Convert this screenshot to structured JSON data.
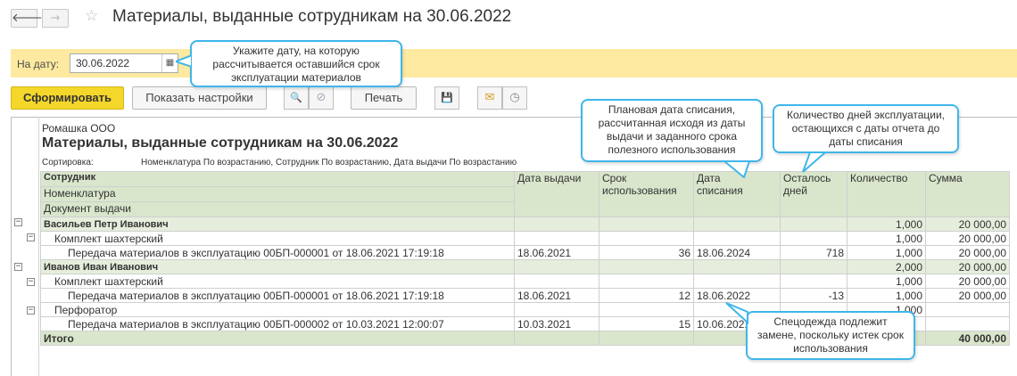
{
  "window": {
    "title": "Материалы, выданные сотрудникам на 30.06.2022",
    "back_glyph": "🡐",
    "fwd_glyph": "→",
    "star_glyph": "☆"
  },
  "datebar": {
    "label": "На дату:",
    "value": "30.06.2022",
    "calendar_glyph": "▦"
  },
  "toolbar": {
    "generate_label": "Сформировать",
    "settings_label": "Показать настройки",
    "print_label": "Печать",
    "search_glyph": "🔍",
    "clear_glyph": "⊘",
    "save_glyph": "💾",
    "mail_glyph": "✉",
    "clock_glyph": "◷"
  },
  "report": {
    "org": "Ромашка ООО",
    "title": "Материалы, выданные сотрудникам на 30.06.2022",
    "sort_label": "Сортировка:",
    "sort_value": "Номенклатура По возрастанию, Сотрудник По возрастанию, Дата выдачи По возрастанию",
    "headers": {
      "employee": "Сотрудник",
      "nomenclature": "Номенклатура",
      "document": "Документ выдачи",
      "issue_date": "Дата выдачи",
      "usage_term_1": "Срок",
      "usage_term_2": "использования",
      "writeoff_1": "Дата",
      "writeoff_2": "списания",
      "remaining_1": "Осталось",
      "remaining_2": "дней",
      "quantity": "Количество",
      "sum": "Сумма"
    },
    "rows": [
      {
        "name": "Васильев Петр Иванович",
        "qty": "1,000",
        "sum": "20 000,00"
      },
      {
        "name": "Комплект шахтерский",
        "qty": "1,000",
        "sum": "20 000,00"
      },
      {
        "name": "Передача материалов в эксплуатацию 00БП-000001 от 18.06.2021 17:19:18",
        "issue": "18.06.2021",
        "term": "36",
        "writeoff": "18.06.2024",
        "remain": "718",
        "qty": "1,000",
        "sum": "20 000,00"
      },
      {
        "name": "Иванов Иван Иванович",
        "qty": "2,000",
        "sum": "20 000,00"
      },
      {
        "name": "Комплект шахтерский",
        "qty": "1,000",
        "sum": "20 000,00"
      },
      {
        "name": "Передача материалов в эксплуатацию 00БП-000001 от 18.06.2021 17:19:18",
        "issue": "18.06.2021",
        "term": "12",
        "writeoff": "18.06.2022",
        "remain": "-13",
        "qty": "1,000",
        "sum": "20 000,00"
      },
      {
        "name": "Перфоратор",
        "qty": "1,000",
        "sum": ""
      },
      {
        "name": "Передача материалов в эксплуатацию 00БП-000002 от 10.03.2021 12:00:07",
        "issue": "10.03.2021",
        "term": "15",
        "writeoff": "10.06.2021",
        "remain": "",
        "qty": "",
        "sum": ""
      },
      {
        "name": "Итого",
        "qty": "",
        "sum": "40 000,00"
      }
    ],
    "toggle_glyph": "−"
  },
  "callouts": {
    "date_hint": "Укажите дату, на которую рассчитывается оставшийся срок эксплуатации материалов",
    "writeoff_hint": "Плановая дата списания, рассчитанная исходя из даты выдачи и заданного срока полезного использования",
    "days_hint": "Количество дней эксплуатации, остающихся с даты отчета до даты списания",
    "replace_hint": "Спецодежда подлежит замене, поскольку истек срок использования"
  },
  "colors": {
    "accent_yellow": "#f5d72b",
    "date_strip": "#fdeaa0",
    "header_green": "#d9e6cc",
    "overdue_red": "#e0302b",
    "callout_border": "#3fb6ea"
  }
}
